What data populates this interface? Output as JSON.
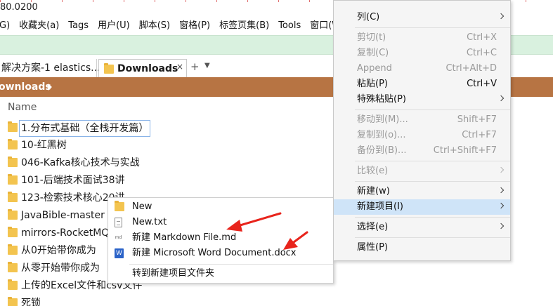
{
  "titlebar": {
    "address": "80.0200"
  },
  "menubar": [
    "G)",
    "收藏夹(a)",
    "Tags",
    "用户(U)",
    "脚本(S)",
    "窗格(P)",
    "标签页集(B)",
    "Tools",
    "窗口(W"
  ],
  "tabs": [
    {
      "label": "解决方案-1 elastics...",
      "active": false
    },
    {
      "label": "Downloads",
      "active": true,
      "close": "×"
    }
  ],
  "tab_add": "+",
  "tab_menu": "▼",
  "breadcrumb": {
    "label": "ownloads"
  },
  "filelist": {
    "header": "Name",
    "items": [
      "1.分布式基础（全栈开发篇）",
      "10-红黑树",
      "046-Kafka核心技术与实战",
      "101-后端技术面试38讲",
      "123-检索技术核心20讲",
      "JavaBible-master",
      "mirrors-RocketMQ",
      "从0开始带你成为",
      "从零开始带你成为",
      "上传的Excel文件和csv文件",
      "死锁"
    ]
  },
  "submenu": {
    "items": [
      {
        "label": "New",
        "icon": "folder-icon"
      },
      {
        "label": "New.txt",
        "icon": "text-file-icon"
      },
      {
        "label": "新建 Markdown File.md",
        "icon": "markdown-file-icon",
        "icon_text": "md"
      },
      {
        "label": "新建 Microsoft Word Document.docx",
        "icon": "word-doc-icon",
        "icon_text": "W"
      },
      {
        "label": "转到新建项目文件夹",
        "icon": ""
      }
    ]
  },
  "context_menu": {
    "items": [
      {
        "label": "列(C)",
        "shortcut": "",
        "submenu": true,
        "disabled": false
      },
      {
        "label": "剪切(t)",
        "shortcut": "Ctrl+X",
        "submenu": false,
        "disabled": true
      },
      {
        "label": "复制(C)",
        "shortcut": "Ctrl+C",
        "submenu": false,
        "disabled": true
      },
      {
        "label": "Append",
        "shortcut": "Ctrl+Alt+D",
        "submenu": false,
        "disabled": true
      },
      {
        "label": "粘贴(P)",
        "shortcut": "Ctrl+V",
        "submenu": false,
        "disabled": false
      },
      {
        "label": "特殊粘贴(P)",
        "shortcut": "",
        "submenu": true,
        "disabled": false
      },
      {
        "label": "移动到(M)...",
        "shortcut": "Shift+F7",
        "submenu": false,
        "disabled": true
      },
      {
        "label": "复制到(o)...",
        "shortcut": "Ctrl+F7",
        "submenu": false,
        "disabled": true
      },
      {
        "label": "备份到(B)...",
        "shortcut": "Ctrl+Shift+F7",
        "submenu": false,
        "disabled": true
      },
      {
        "label": "比较(e)",
        "shortcut": "",
        "submenu": true,
        "disabled": true
      },
      {
        "label": "新建(w)",
        "shortcut": "",
        "submenu": true,
        "disabled": false
      },
      {
        "label": "新建项目(I)",
        "shortcut": "",
        "submenu": true,
        "disabled": false,
        "highlighted": true
      },
      {
        "label": "选择(e)",
        "shortcut": "",
        "submenu": true,
        "disabled": false
      },
      {
        "label": "属性(P)",
        "shortcut": "",
        "submenu": false,
        "disabled": false
      }
    ]
  },
  "colors": {
    "breadcrumb_bg": "#b77443",
    "toolbar_bg": "#d9f1df",
    "highlight": "#cfe4f8",
    "annotation_arrow": "#e8241c",
    "folder": "#f3c44f"
  }
}
